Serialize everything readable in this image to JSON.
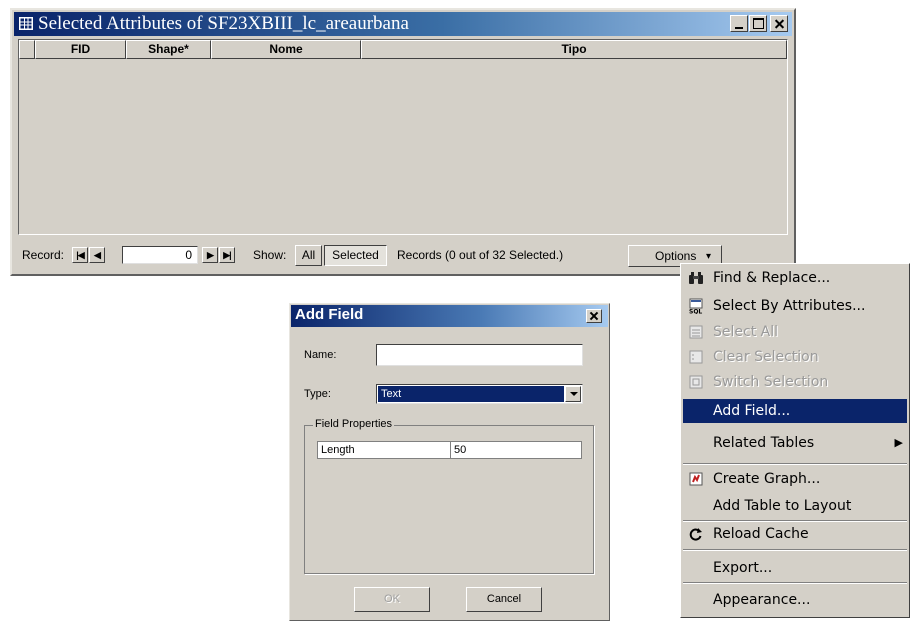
{
  "attr_window": {
    "title": "Selected Attributes of SF23XBIII_lc_areaurbana",
    "columns": [
      "FID",
      "Shape*",
      "Nome",
      "Tipo"
    ],
    "record_label": "Record:",
    "record_value": "0",
    "nav_first": "|◀",
    "nav_prev": "◀",
    "nav_next": "▶",
    "nav_last": "▶|",
    "show_label": "Show:",
    "show_all": "All",
    "show_selected": "Selected",
    "records_status": "Records  (0 out of 32 Selected.)",
    "options_label": "Options",
    "options_arrow": "▾"
  },
  "add_field_dialog": {
    "title": "Add Field",
    "name_label": "Name:",
    "name_value": "",
    "type_label": "Type:",
    "type_value": "Text",
    "field_properties_label": "Field Properties",
    "properties": [
      {
        "key": "Length",
        "value": "50"
      }
    ],
    "ok_label": "OK",
    "cancel_label": "Cancel"
  },
  "options_menu": {
    "items": [
      {
        "label": "Find & Replace...",
        "icon": "binoculars-icon",
        "state": "enabled"
      },
      {
        "label": "Select By Attributes...",
        "icon": "sql-icon",
        "state": "enabled"
      },
      {
        "label": "Select All",
        "icon": "select-all-icon",
        "state": "disabled"
      },
      {
        "label": "Clear Selection",
        "icon": "clear-selection-icon",
        "state": "disabled"
      },
      {
        "label": "Switch Selection",
        "icon": "switch-selection-icon",
        "state": "disabled"
      },
      {
        "label": "Add Field...",
        "icon": "",
        "state": "highlighted"
      },
      {
        "label": "Related Tables",
        "icon": "",
        "state": "enabled",
        "submenu_arrow": "▶"
      },
      {
        "label": "Create Graph...",
        "icon": "graph-icon",
        "state": "enabled"
      },
      {
        "label": "Add Table to Layout",
        "icon": "",
        "state": "enabled"
      },
      {
        "label": "Reload Cache",
        "icon": "reload-icon",
        "state": "enabled"
      },
      {
        "label": "Export...",
        "icon": "",
        "state": "enabled"
      },
      {
        "label": "Appearance...",
        "icon": "",
        "state": "enabled"
      }
    ]
  },
  "colors": {
    "titlebar": "#0a246a",
    "face": "#d4d0c8",
    "highlight": "#0a246a"
  }
}
